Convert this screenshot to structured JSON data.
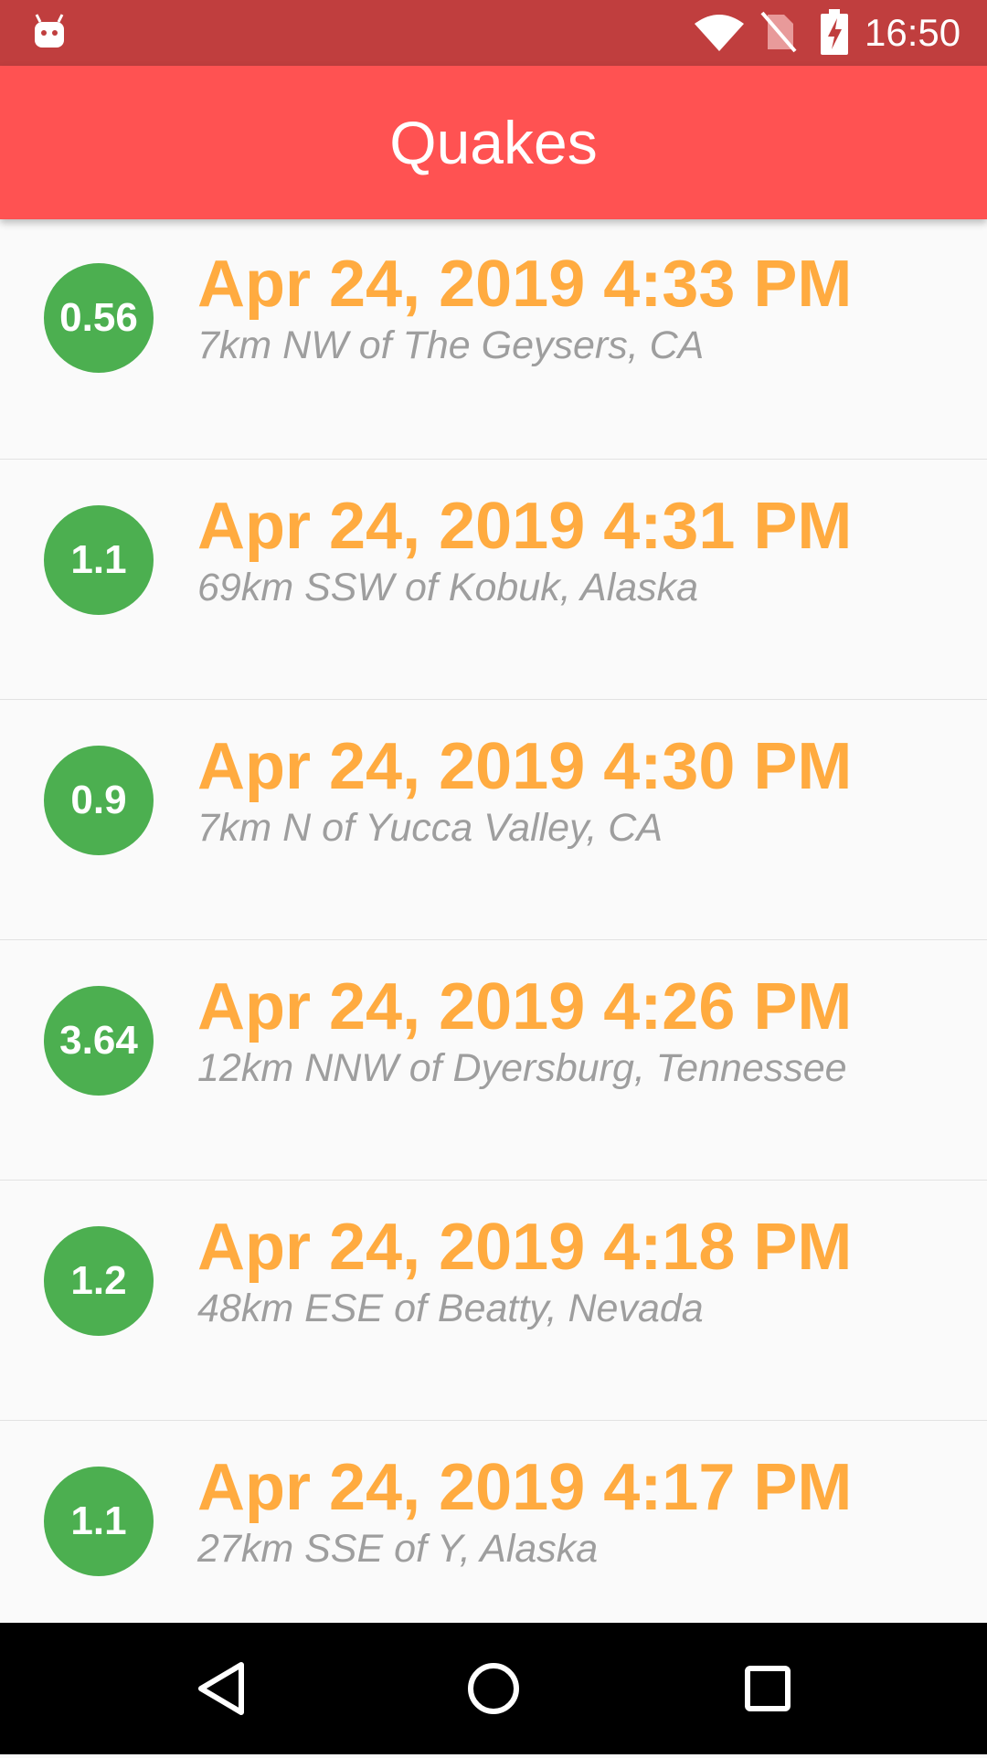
{
  "status_bar": {
    "time": "16:50",
    "icons": [
      "android-debug-icon",
      "wifi-icon",
      "no-sim-icon",
      "battery-charging-icon"
    ]
  },
  "app_bar": {
    "title": "Quakes"
  },
  "quakes": [
    {
      "magnitude": "0.56",
      "date": "Apr 24, 2019 4:33 PM",
      "place": "7km NW of The Geysers, CA"
    },
    {
      "magnitude": "1.1",
      "date": "Apr 24, 2019 4:31 PM",
      "place": "69km SSW of Kobuk, Alaska"
    },
    {
      "magnitude": "0.9",
      "date": "Apr 24, 2019 4:30 PM",
      "place": "7km N of Yucca Valley, CA"
    },
    {
      "magnitude": "3.64",
      "date": "Apr 24, 2019 4:26 PM",
      "place": "12km NNW of Dyersburg, Tennessee"
    },
    {
      "magnitude": "1.2",
      "date": "Apr 24, 2019 4:18 PM",
      "place": "48km ESE of Beatty, Nevada"
    },
    {
      "magnitude": "1.1",
      "date": "Apr 24, 2019 4:17 PM",
      "place": "27km SSE of Y, Alaska"
    }
  ],
  "colors": {
    "status_bar": "#c03e3e",
    "app_bar": "#ff5252",
    "magnitude_circle": "#4caf50",
    "date_text": "#ffab40",
    "place_text": "#9e9e9e"
  },
  "nav_bar": {
    "icons": [
      "back-icon",
      "home-icon",
      "recents-icon"
    ]
  }
}
